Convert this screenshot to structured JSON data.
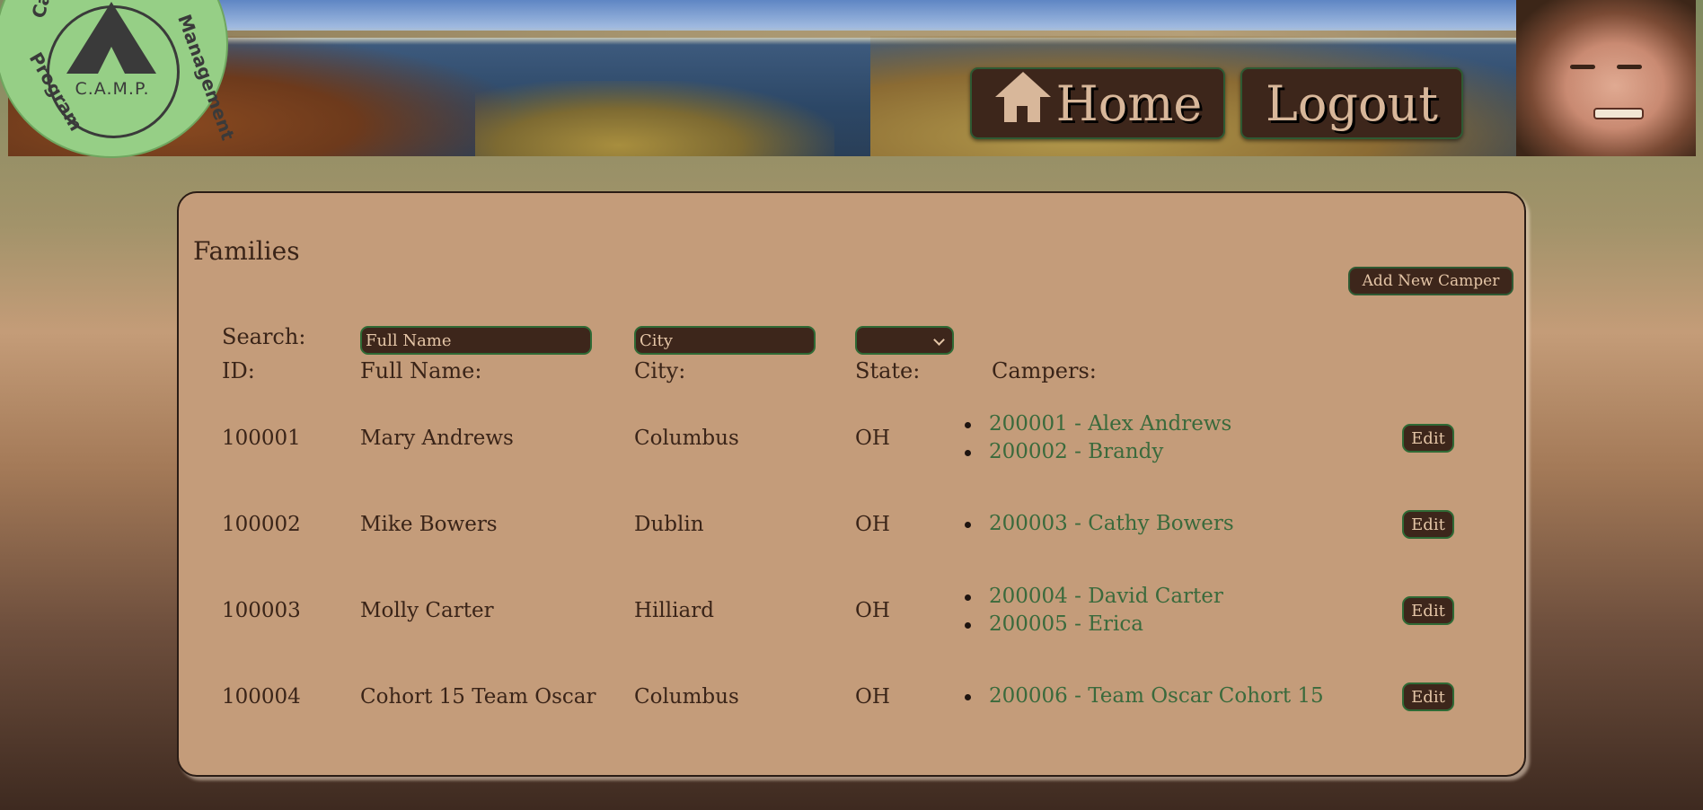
{
  "header": {
    "logo": {
      "center_text": "C.A.M.P.",
      "ring_text": [
        "Cam",
        "Program",
        "Management"
      ]
    },
    "nav": {
      "home_label": "Home",
      "logout_label": "Logout"
    }
  },
  "families": {
    "title": "Families",
    "add_button_label": "Add New Camper",
    "search": {
      "label": "Search:",
      "name_placeholder": "Full Name",
      "city_placeholder": "City",
      "state_selected": ""
    },
    "columns": {
      "id": "ID:",
      "name": "Full Name:",
      "city": "City:",
      "state": "State:",
      "campers": "Campers:"
    },
    "edit_label": "Edit",
    "rows": [
      {
        "id": "100001",
        "name": "Mary Andrews",
        "city": "Columbus",
        "state": "OH",
        "campers": [
          "200001 - Alex Andrews",
          "200002 - Brandy"
        ]
      },
      {
        "id": "100002",
        "name": "Mike Bowers",
        "city": "Dublin",
        "state": "OH",
        "campers": [
          "200003 - Cathy Bowers"
        ]
      },
      {
        "id": "100003",
        "name": "Molly Carter",
        "city": "Hilliard",
        "state": "OH",
        "campers": [
          "200004 - David Carter",
          "200005 - Erica"
        ]
      },
      {
        "id": "100004",
        "name": "Cohort 15 Team Oscar",
        "city": "Columbus",
        "state": "OH",
        "campers": [
          "200006 - Team Oscar Cohort 15"
        ]
      }
    ]
  },
  "colors": {
    "panel": "#c49c7a",
    "button_bg": "#3d261b",
    "button_text": "#e4c5a6",
    "link": "#3a6a3c",
    "logo_green": "#96cf86"
  }
}
